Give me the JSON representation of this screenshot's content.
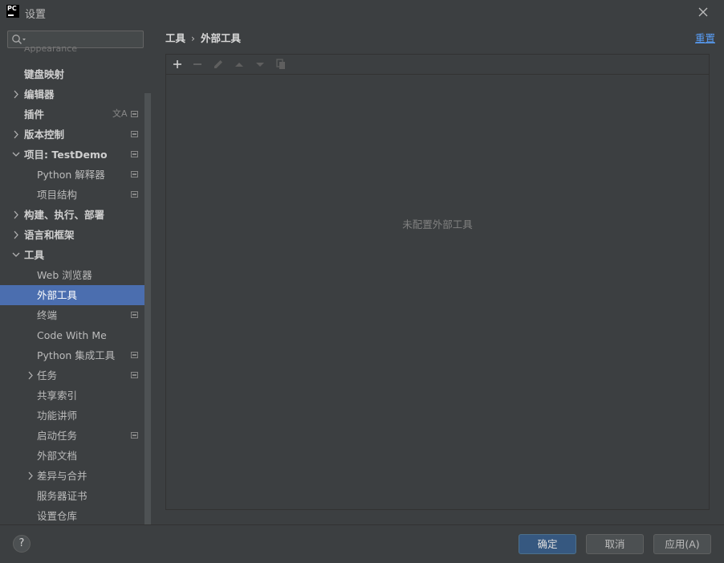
{
  "window": {
    "app_logo_text": "PC",
    "title": "设置"
  },
  "search": {
    "placeholder": "",
    "value": ""
  },
  "sidebar": {
    "faded_top_label": "Appearance",
    "items": [
      {
        "label": "键盘映射",
        "bold": true,
        "expand": "none",
        "indent": 0,
        "icon": ""
      },
      {
        "label": "编辑器",
        "bold": true,
        "expand": "collapsed",
        "indent": 0,
        "icon": ""
      },
      {
        "label": "插件",
        "bold": true,
        "expand": "none",
        "indent": 0,
        "icon": "translate"
      },
      {
        "label": "版本控制",
        "bold": true,
        "expand": "collapsed",
        "indent": 0,
        "icon": "project"
      },
      {
        "label": "项目: TestDemo",
        "bold": true,
        "expand": "expanded",
        "indent": 0,
        "icon": "project"
      },
      {
        "label": "Python 解释器",
        "bold": false,
        "expand": "none",
        "indent": 1,
        "icon": "project"
      },
      {
        "label": "项目结构",
        "bold": false,
        "expand": "none",
        "indent": 1,
        "icon": "project"
      },
      {
        "label": "构建、执行、部署",
        "bold": true,
        "expand": "collapsed",
        "indent": 0,
        "icon": ""
      },
      {
        "label": "语言和框架",
        "bold": true,
        "expand": "collapsed",
        "indent": 0,
        "icon": ""
      },
      {
        "label": "工具",
        "bold": true,
        "expand": "expanded",
        "indent": 0,
        "icon": ""
      },
      {
        "label": "Web 浏览器",
        "bold": false,
        "expand": "none",
        "indent": 1,
        "icon": ""
      },
      {
        "label": "外部工具",
        "bold": false,
        "expand": "none",
        "indent": 1,
        "icon": "",
        "selected": true
      },
      {
        "label": "终端",
        "bold": false,
        "expand": "none",
        "indent": 1,
        "icon": "project"
      },
      {
        "label": "Code With Me",
        "bold": false,
        "expand": "none",
        "indent": 1,
        "icon": ""
      },
      {
        "label": "Python 集成工具",
        "bold": false,
        "expand": "none",
        "indent": 1,
        "icon": "project"
      },
      {
        "label": "任务",
        "bold": false,
        "expand": "collapsed",
        "indent": 1,
        "icon": "project"
      },
      {
        "label": "共享索引",
        "bold": false,
        "expand": "none",
        "indent": 1,
        "icon": ""
      },
      {
        "label": "功能讲师",
        "bold": false,
        "expand": "none",
        "indent": 1,
        "icon": ""
      },
      {
        "label": "启动任务",
        "bold": false,
        "expand": "none",
        "indent": 1,
        "icon": "project"
      },
      {
        "label": "外部文档",
        "bold": false,
        "expand": "none",
        "indent": 1,
        "icon": ""
      },
      {
        "label": "差异与合并",
        "bold": false,
        "expand": "collapsed",
        "indent": 1,
        "icon": ""
      },
      {
        "label": "服务器证书",
        "bold": false,
        "expand": "none",
        "indent": 1,
        "icon": ""
      },
      {
        "label": "设置仓库",
        "bold": false,
        "expand": "none",
        "indent": 1,
        "icon": ""
      }
    ]
  },
  "main": {
    "breadcrumb": [
      "工具",
      "外部工具"
    ],
    "breadcrumb_sep": "›",
    "reset_label": "重置",
    "empty_text": "未配置外部工具",
    "toolbar": [
      "add-icon",
      "remove-icon",
      "edit-icon",
      "move-up-icon",
      "move-down-icon",
      "copy-icon"
    ]
  },
  "footer": {
    "help_label": "?",
    "ok_label": "确定",
    "cancel_label": "取消",
    "apply_label": "应用(A)"
  },
  "colors": {
    "background": "#3c3f41",
    "selection": "#4b6eaf",
    "link": "#589df6",
    "primary_button": "#365880"
  }
}
